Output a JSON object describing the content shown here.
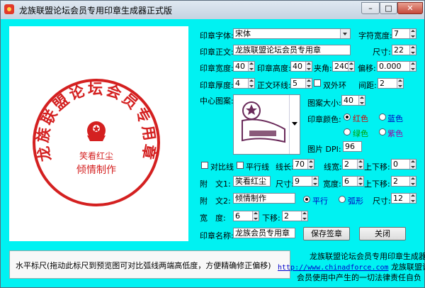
{
  "window": {
    "title": "龙族联盟论坛会员专用印章生成器正式版",
    "controls": {
      "minimize": "–",
      "maximize": "□",
      "close": "✕"
    }
  },
  "stamp": {
    "arc_text": "龙族联盟论坛会员专用章",
    "line1": "笑看红尘",
    "line2": "倾情制作",
    "color": "#d42020"
  },
  "form": {
    "font_label": "印章字体:",
    "font_value": "宋体",
    "char_width_label": "字符宽度:",
    "char_width_value": "7",
    "body_text_label": "印章正文:",
    "body_text_value": "龙族联盟论坛会员专用章",
    "size_label": "尺寸:",
    "size_value": "22",
    "seal_width_label": "印章宽度:",
    "seal_width_value": "40",
    "seal_height_label": "印章高度:",
    "seal_height_value": "40",
    "angle_label": "夹角:",
    "angle_value": "240",
    "offset_label": "偏移:",
    "offset_value": "0.000",
    "thickness_label": "印章厚度:",
    "thickness_value": "4",
    "ring_label": "正文环线:",
    "ring_value": "5",
    "double_ring_label": "双外环",
    "spacing_label": "间距:",
    "spacing_value": "2",
    "center_pattern_label": "中心图案:",
    "pattern_size_label": "图案大小:",
    "pattern_size_value": "40",
    "pattern_color_label": "印章颜色:",
    "colors": [
      {
        "label": "红色",
        "color": "#d40000",
        "selected": true
      },
      {
        "label": "蓝色",
        "color": "#0000c0",
        "selected": false
      },
      {
        "label": "绿色",
        "color": "#00a000",
        "selected": false
      },
      {
        "label": "紫色",
        "color": "#a000a0",
        "selected": false
      }
    ],
    "dpi_label": "图片 DPI:",
    "dpi_value": "96",
    "compare_line_label": "对比线",
    "parallel_line_label": "平行线",
    "line_length_label": "线长:",
    "line_length_value": "70",
    "line_width_label": "线宽:",
    "line_width_value": "2",
    "updown_label": "上下移:",
    "updown_value": "0",
    "sub1_label": "附　文1:",
    "sub1_value": "笑看红尘",
    "sub1_size_label": "尺寸:",
    "sub1_size_value": "9",
    "sub1_width_label": "宽度:",
    "sub1_width_value": "6",
    "sub1_updown_label": "上下移:",
    "sub1_updown_value": "2",
    "sub2_label": "附　文2:",
    "sub2_value": "倾情制作",
    "parallel_label": "平行",
    "arc_label": "弧形",
    "sub2_size_label": "尺寸:",
    "sub2_size_value": "12",
    "width_label": "宽　度:",
    "width_value": "6",
    "width_updown_label": "下移:",
    "width_updown_value": "2",
    "seal_name_label": "印章名称:",
    "seal_name_value": "龙族会员专用章",
    "save_button": "保存签章",
    "close_button": "关闭"
  },
  "status": {
    "hint": "水平标尺(拖动此标尺到预览图可对比弧线两端高低度，方便精确修正偏移)"
  },
  "footer": {
    "line1": "龙族联盟论坛会员专用印章生成器",
    "url": "http://www.chinadforce.com",
    "line2_suffix": " 龙族联盟论坛",
    "line3": "会员使用中产生的一切法律责任自负"
  }
}
